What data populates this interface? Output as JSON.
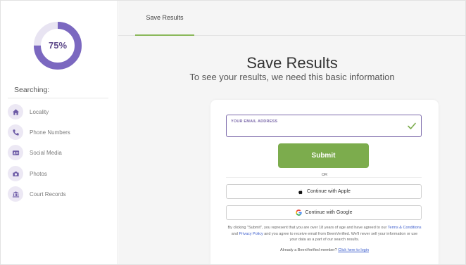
{
  "sidebar": {
    "progress": {
      "value": 0.75,
      "label": "75%",
      "color": "#7b68c0",
      "track_color": "#e8e4f2"
    },
    "searching_label": "Searching:",
    "items": [
      {
        "label": "Locality",
        "icon": "home-icon"
      },
      {
        "label": "Phone Numbers",
        "icon": "phone-icon"
      },
      {
        "label": "Social Media",
        "icon": "id-card-icon"
      },
      {
        "label": "Photos",
        "icon": "camera-icon"
      },
      {
        "label": "Court Records",
        "icon": "courthouse-icon"
      }
    ]
  },
  "header": {
    "tab_label": "Save Results",
    "tab_accent": "#8bb85a"
  },
  "main": {
    "title": "Save Results",
    "subtitle": "To see your results, we need this basic information"
  },
  "form": {
    "email_label": "YOUR EMAIL ADDRESS",
    "email_value": "",
    "submit_label": "Submit",
    "submit_color": "#7cac4d",
    "or_label": "OR",
    "apple_label": "Continue with Apple",
    "google_label": "Continue with Google",
    "legal": {
      "part1": "By clicking \"Submit\", you represent that you are over 18 years of age and have agreed to our ",
      "terms_link": "Terms & Conditions",
      "part2": " and ",
      "privacy_link": "Privacy Policy",
      "part3": " and you agree to receive email from BeenVerified. We'll never sell your information or use your data as a part of our search results."
    },
    "member_prefix": "Already a BeenVerified member? ",
    "member_link": "Click here to login"
  }
}
